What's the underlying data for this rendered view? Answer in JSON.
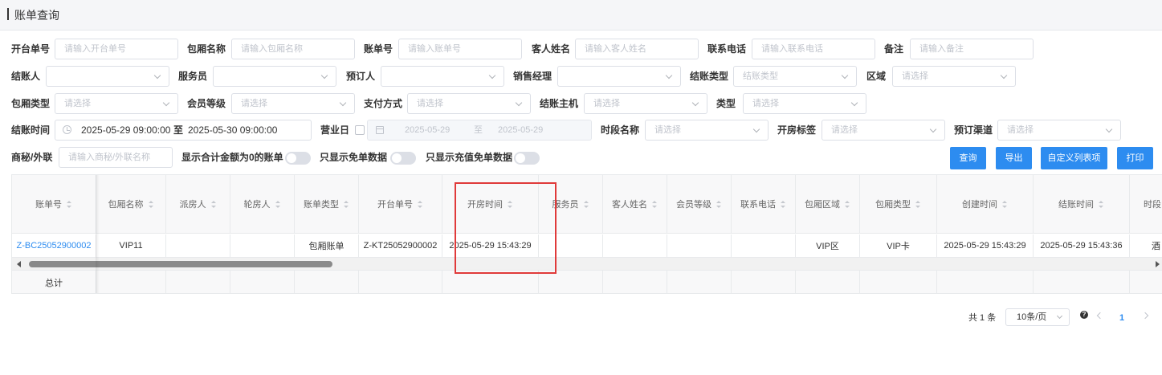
{
  "page": {
    "title": "账单查询"
  },
  "filters": {
    "row1": [
      {
        "label": "开台单号",
        "placeholder": "请输入开台单号"
      },
      {
        "label": "包厢名称",
        "placeholder": "请输入包厢名称"
      },
      {
        "label": "账单号",
        "placeholder": "请输入账单号"
      },
      {
        "label": "客人姓名",
        "placeholder": "请输入客人姓名"
      },
      {
        "label": "联系电话",
        "placeholder": "请输入联系电话"
      },
      {
        "label": "备注",
        "placeholder": "请输入备注"
      }
    ],
    "row2": [
      {
        "label": "结账人",
        "placeholder": ""
      },
      {
        "label": "服务员",
        "placeholder": ""
      },
      {
        "label": "预订人",
        "placeholder": ""
      },
      {
        "label": "销售经理",
        "placeholder": ""
      },
      {
        "label": "结账类型",
        "placeholder": "结账类型"
      },
      {
        "label": "区域",
        "placeholder": "请选择"
      }
    ],
    "row3": [
      {
        "label": "包厢类型",
        "placeholder": "请选择"
      },
      {
        "label": "会员等级",
        "placeholder": "请选择"
      },
      {
        "label": "支付方式",
        "placeholder": "请选择"
      },
      {
        "label": "结账主机",
        "placeholder": "请选择"
      },
      {
        "label": "类型",
        "placeholder": "请选择"
      }
    ],
    "row4": {
      "checkout_time_label": "结账时间",
      "checkout_start": "2025-05-29 09:00:00",
      "range_sep": "至",
      "checkout_end": "2025-05-30 09:00:00",
      "business_day_label": "营业日",
      "business_start": "2025-05-29",
      "business_sep": "至",
      "business_end": "2025-05-29",
      "period_label": "时段名称",
      "period_placeholder": "请选择",
      "room_tag_label": "开房标签",
      "room_tag_placeholder": "请选择",
      "channel_label": "预订渠道",
      "channel_placeholder": "请选择"
    },
    "row5": {
      "merchant_label": "商秘/外联",
      "merchant_placeholder": "请输入商秘/外联名称",
      "zero_bill_label": "显示合计金额为0的账单",
      "free_only_label": "只显示免单数据",
      "recharge_free_label": "只显示充值免单数据"
    }
  },
  "buttons": {
    "query": "查询",
    "export": "导出",
    "custom_columns": "自定义列表项",
    "print": "打印"
  },
  "table": {
    "columns": [
      "账单号",
      "包厢名称",
      "派房人",
      "轮房人",
      "账单类型",
      "开台单号",
      "开房时间",
      "服务员",
      "客人姓名",
      "会员等级",
      "联系电话",
      "包厢区域",
      "包厢类型",
      "创建时间",
      "结账时间",
      "时段"
    ],
    "rows": [
      [
        "Z-BC25052900002",
        "VIP11",
        "",
        "",
        "包厢账单",
        "Z-KT25052900002",
        "2025-05-29 15:43:29",
        "",
        "",
        "",
        "",
        "VIP区",
        "VIP卡",
        "2025-05-29 15:43:29",
        "2025-05-29 15:43:36",
        "酒"
      ]
    ],
    "summary_label": "总计"
  },
  "pagination": {
    "total": "共 1 条",
    "page_size": "10条/页",
    "current_page": "1",
    "help": "?"
  },
  "colors": {
    "accent": "#2d8cf0",
    "highlight": "#e03a3a"
  }
}
